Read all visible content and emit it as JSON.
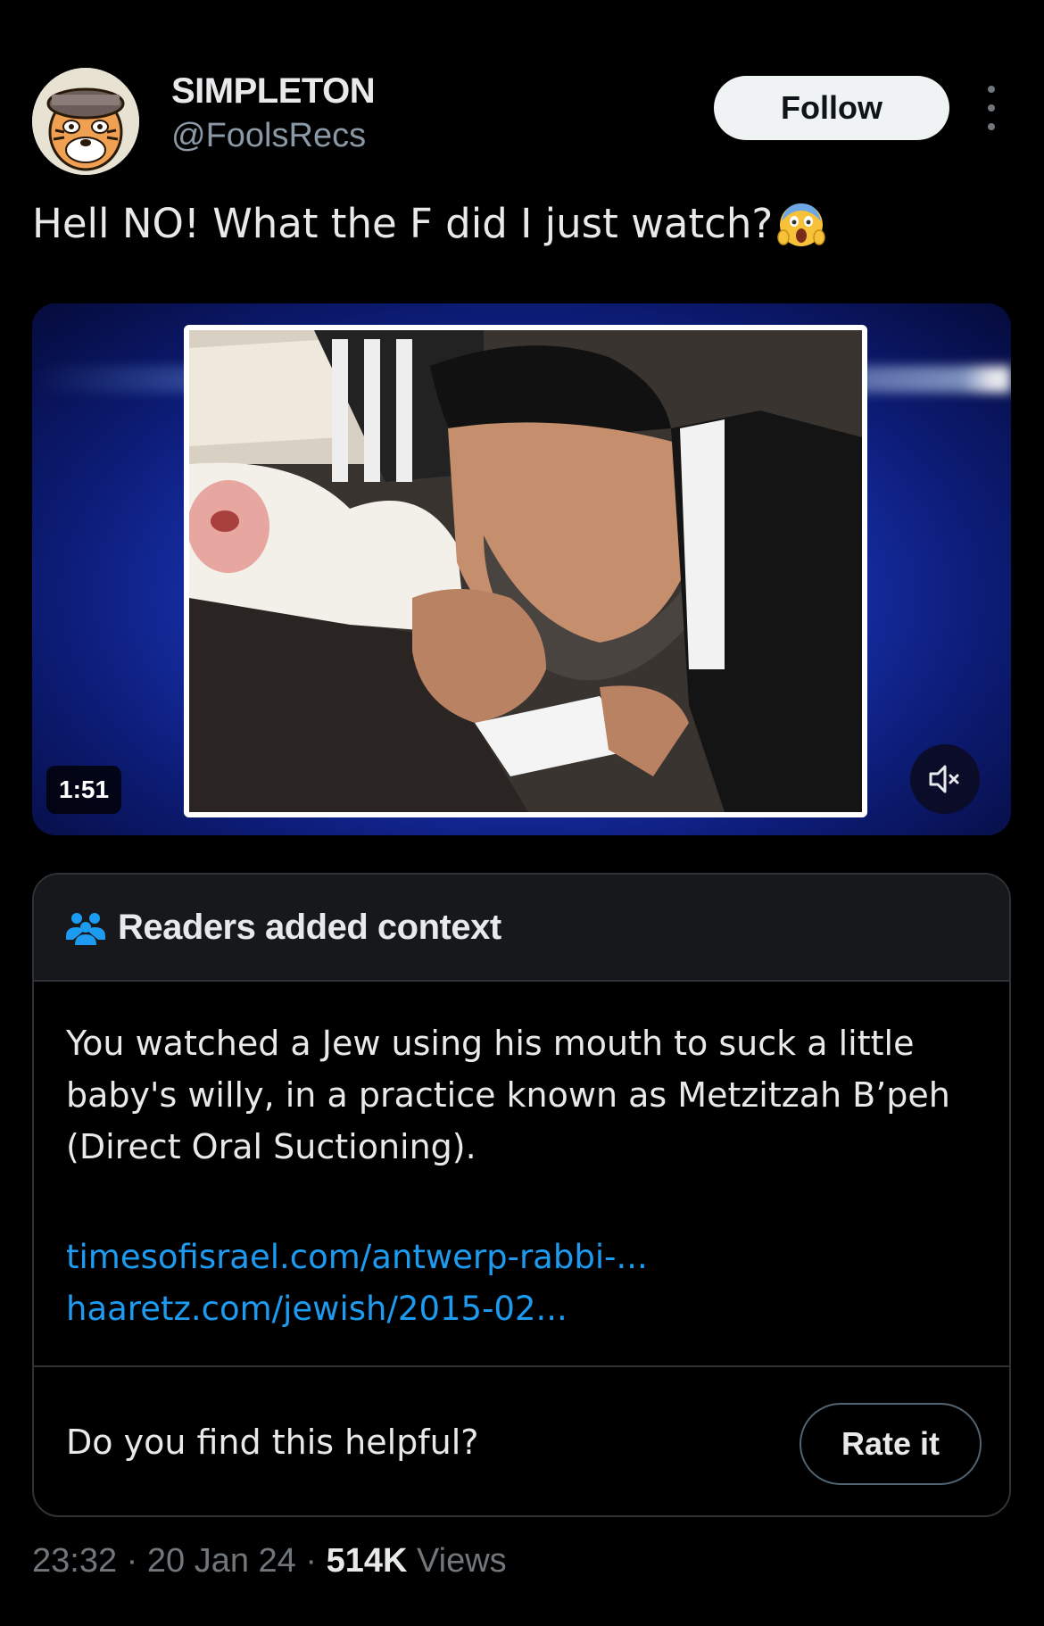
{
  "author": {
    "display_name": "SIMPLETON",
    "handle": "@FoolsRecs",
    "follow_label": "Follow",
    "avatar_icon": "cartoon-tiger-avatar"
  },
  "tweet": {
    "text": "Hell NO! What the F did I just watch?",
    "emoji": "face-screaming-in-fear"
  },
  "media": {
    "duration": "1:51",
    "mute_icon": "speaker-muted-icon"
  },
  "note": {
    "title": "Readers added context",
    "body": "You watched a Jew using his mouth to suck a little baby's willy, in a practice known as Metzitzah B’peh (Direct Oral Suctioning).",
    "links": [
      "timesofisrael.com/antwerp-rabbi-...",
      "haaretz.com/jewish/2015-02..."
    ],
    "helpful_question": "Do you find this helpful?",
    "rate_label": "Rate it"
  },
  "meta": {
    "time": "23:32",
    "date": "20 Jan 24",
    "views_count": "514K",
    "views_label": "Views"
  },
  "colors": {
    "background": "#000000",
    "link": "#1d9bf0",
    "secondary_text": "#71767b",
    "border": "#2f3336",
    "note_header_bg": "#16181c"
  }
}
